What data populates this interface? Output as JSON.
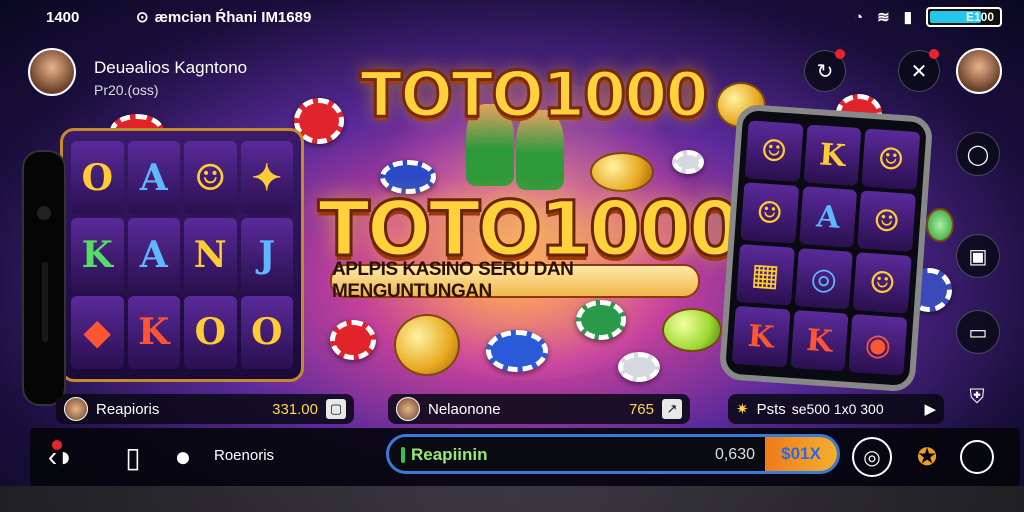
{
  "status_bar": {
    "time": "1400",
    "notification_text": "æmciən Ŕhani IM1689",
    "battery_percent_text": "E100",
    "battery_level": 0.75
  },
  "header": {
    "profile_name": "Deuəalios Kagntono",
    "profile_sub": "Pr20.(oss)"
  },
  "title": {
    "top": "TOTO1000",
    "main": "TOTO1000",
    "subtitle": "APLPIS KASINO SERU DAN MENGUNTUNGAN"
  },
  "info_bars": [
    {
      "name": "Reapioris",
      "value": "331.00",
      "icon": "square-icon"
    },
    {
      "name": "Nelaonone",
      "value": "765",
      "icon": "arrow-icon"
    },
    {
      "name": "Psts",
      "value": "se500 1x0 300",
      "icon": "play-icon"
    }
  ],
  "bottom_bar": {
    "label": "Roenoris",
    "progress_label": "Reapiinin",
    "progress_amount": "0,630",
    "multiplier": "$01X"
  },
  "colors": {
    "accent_gold": "#ffd23c",
    "progress_border": "#3a7ad8",
    "battery": "#25c7e8",
    "notification": "#e8242a"
  },
  "icons": {
    "status": [
      "clock-icon",
      "wifi-icon",
      "signal-icon",
      "battery-icon"
    ],
    "header_right": [
      "refresh-icon",
      "close-icon",
      "avatar"
    ],
    "side_right": [
      "chat-icon",
      "camera-icon",
      "screen-icon",
      "shield-icon"
    ],
    "bottom": [
      "back-icon",
      "phone-icon",
      "mic-icon",
      "timer-icon",
      "trophy-icon",
      "circle-icon"
    ]
  }
}
